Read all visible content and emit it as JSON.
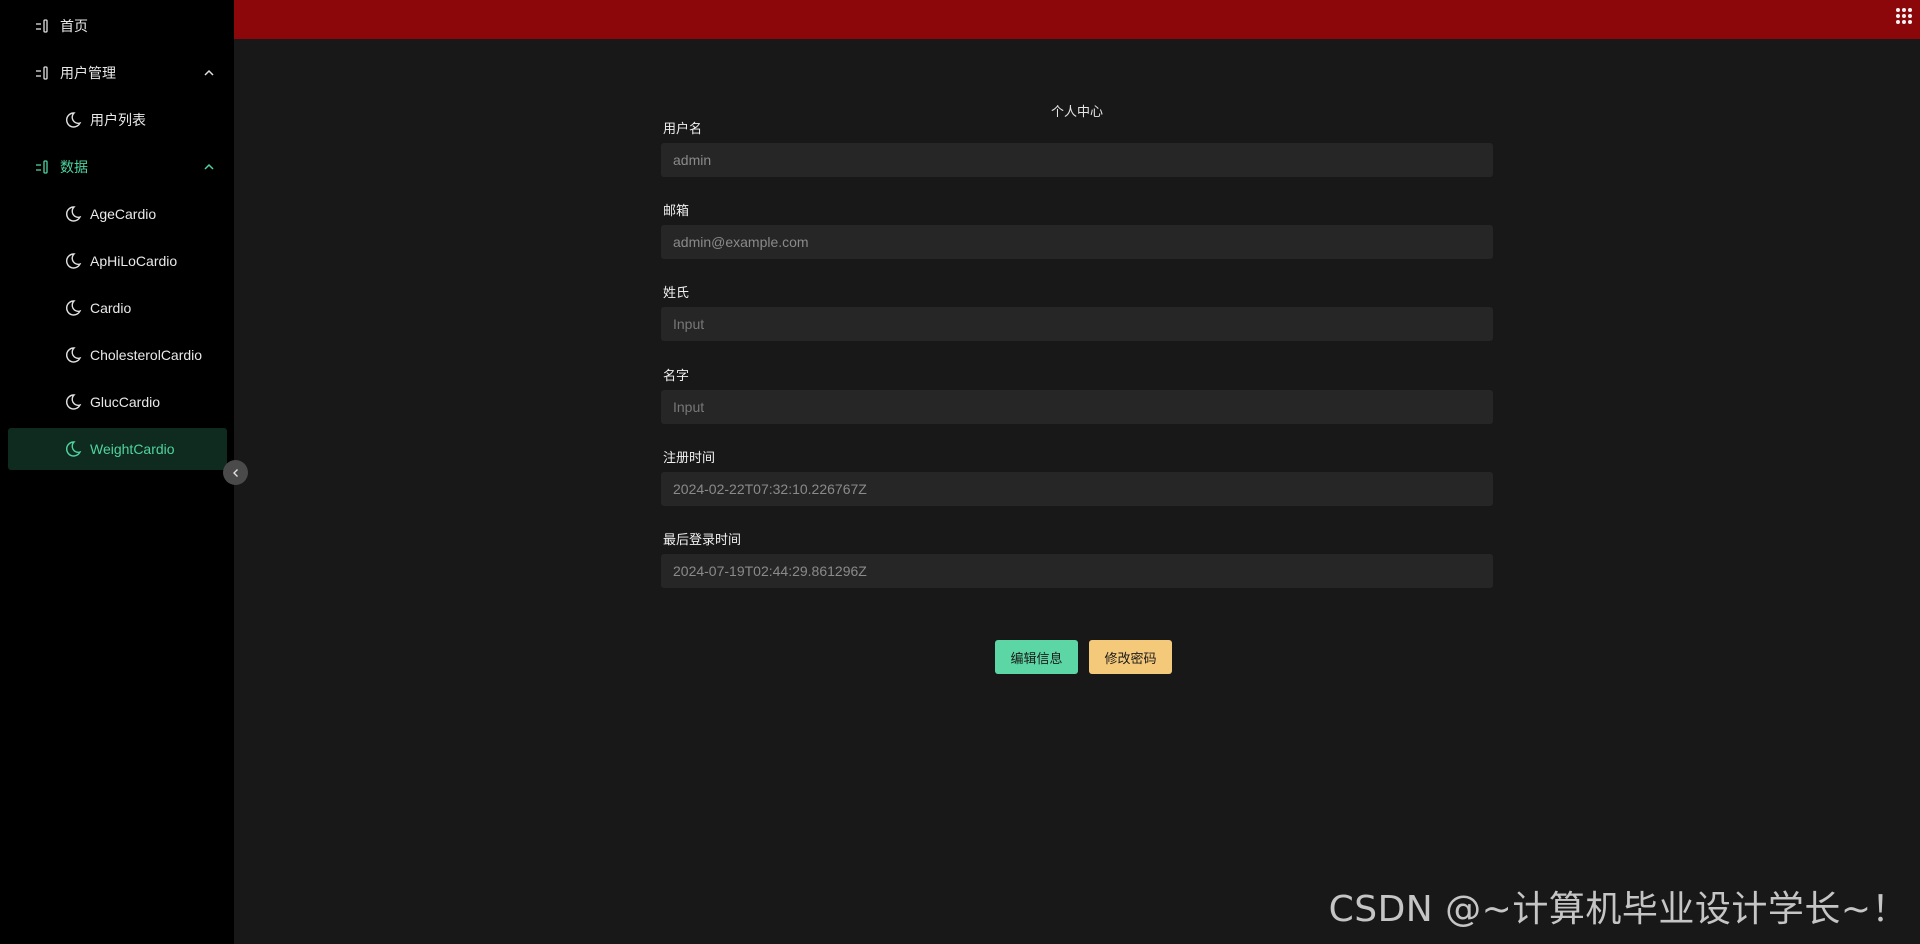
{
  "sidebar": {
    "home_label": "首页",
    "user_mgmt_label": "用户管理",
    "user_list_label": "用户列表",
    "data_label": "数据",
    "data_items": [
      "AgeCardio",
      "ApHiLoCardio",
      "Cardio",
      "CholesterolCardio",
      "GlucCardio",
      "WeightCardio"
    ],
    "selected_item": "WeightCardio"
  },
  "main": {
    "title": "个人中心",
    "fields": {
      "username": {
        "label": "用户名",
        "value": "admin"
      },
      "email": {
        "label": "邮箱",
        "value": "admin@example.com"
      },
      "last_name": {
        "label": "姓氏",
        "placeholder": "Input"
      },
      "first_name": {
        "label": "名字",
        "placeholder": "Input"
      },
      "register_time": {
        "label": "注册时间",
        "value": "2024-02-22T07:32:10.226767Z"
      },
      "last_login": {
        "label": "最后登录时间",
        "value": "2024-07-19T02:44:29.861296Z"
      }
    },
    "buttons": {
      "edit": "编辑信息",
      "change_password": "修改密码"
    }
  },
  "watermark": "CSDN @~计算机毕业设计学长~！",
  "colors": {
    "topbar": "#8b070a",
    "accent": "#4fd39f",
    "edit_button": "#5cd6a4",
    "password_button": "#f5c97a"
  }
}
